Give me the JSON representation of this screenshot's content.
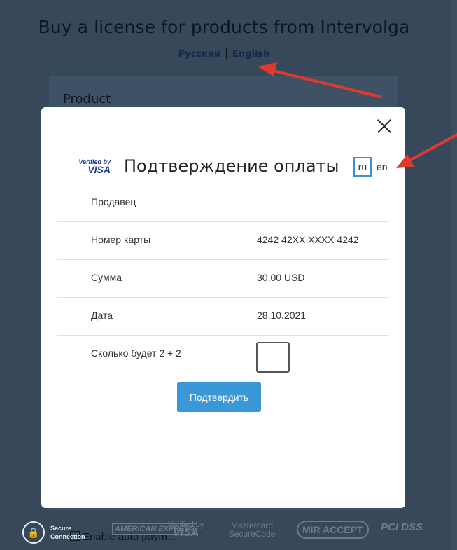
{
  "page": {
    "title": "Buy a license for products from Intervolga",
    "lang_ru": "Русский",
    "lang_en": "English",
    "product_heading": "Product",
    "autopay_label": "Enable auto paym..."
  },
  "footer": {
    "secure_label": "Secure Connection",
    "logos": {
      "amex": "AMERICAN EXPRESS",
      "vbv_top": "Verified by",
      "vbv_bottom": "VISA",
      "mastercard": "Mastercard SecureCode",
      "mir": "MIR ACCEPT",
      "pci": "PCI DSS"
    }
  },
  "modal": {
    "verified_top": "Verified by",
    "verified_bottom": "VISA",
    "title": "Подтверждение оплаты",
    "lang_ru": "ru",
    "lang_en": "en",
    "rows": [
      {
        "label": "Продавец",
        "value": ""
      },
      {
        "label": "Номер карты",
        "value": "4242 42XX XXXX 4242"
      },
      {
        "label": "Сумма",
        "value": "30,00 USD"
      },
      {
        "label": "Дата",
        "value": "28.10.2021"
      }
    ],
    "captcha_label": "Сколько будет 2 + 2",
    "captcha_value": "",
    "confirm_label": "Подтвердить"
  },
  "colors": {
    "overlay": "#36485a",
    "accent": "#3a97d8",
    "arrow": "#e03a2f"
  }
}
